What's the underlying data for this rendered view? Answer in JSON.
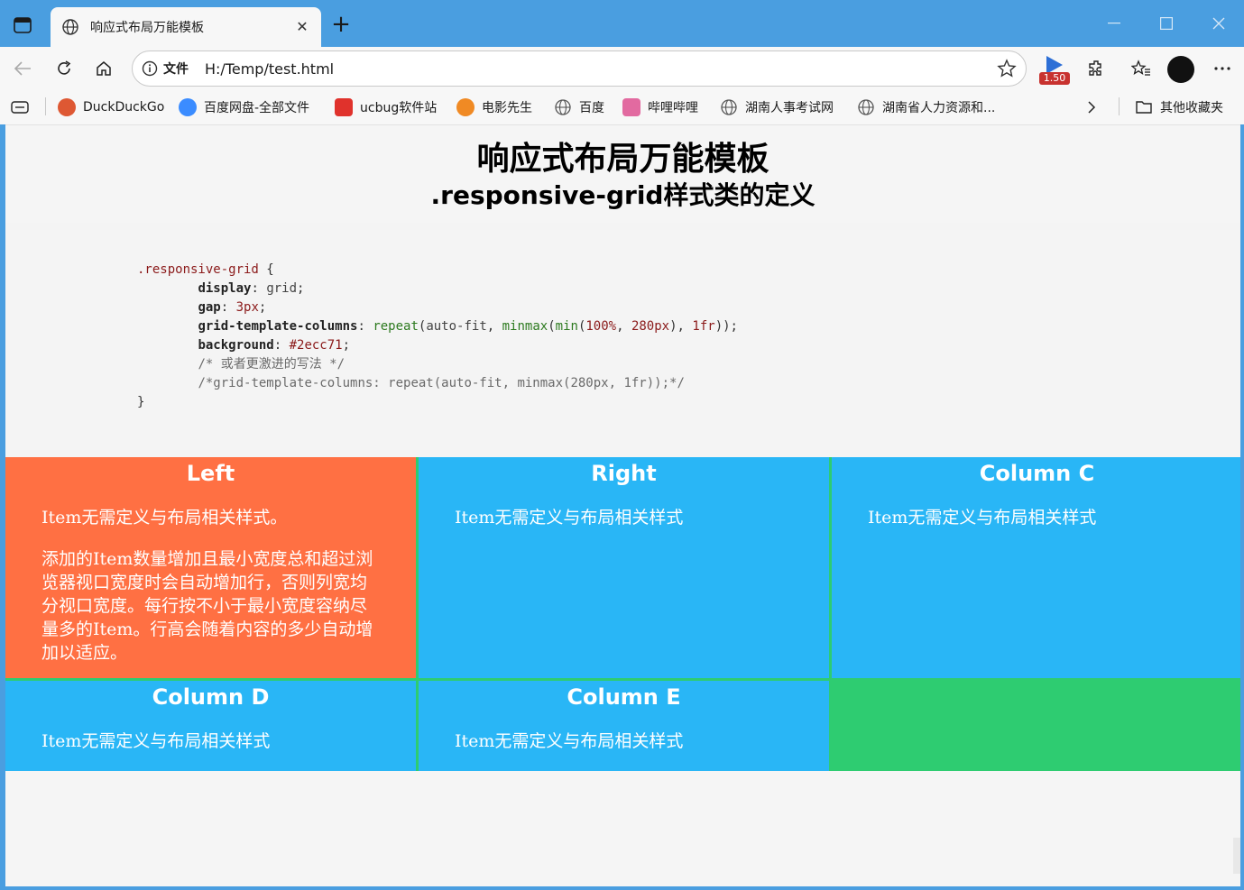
{
  "browser": {
    "tab_title": "响应式布局万能模板",
    "address_scheme": "文件",
    "address_url": "H:/Temp/test.html",
    "playback_rate": "1.50"
  },
  "bookmarks": [
    {
      "label": "DuckDuckGo",
      "color": "#de5833"
    },
    {
      "label": "百度网盘-全部文件",
      "color": "#3b8cff"
    },
    {
      "label": "ucbug软件站",
      "color": "#e0322c"
    },
    {
      "label": "电影先生",
      "color": "#f08a24"
    },
    {
      "label": "百度",
      "color": "#555555"
    },
    {
      "label": "哔哩哔哩",
      "color": "#e26aa0"
    },
    {
      "label": "湖南人事考试网",
      "color": "#555555"
    },
    {
      "label": "湖南省人力资源和...",
      "color": "#555555"
    }
  ],
  "other_bookmarks": "其他收藏夹",
  "page": {
    "title": "响应式布局万能模板",
    "subtitle": ".responsive-grid样式类的定义"
  },
  "grid": {
    "background": "#2ecc71",
    "items": [
      {
        "title": "Left",
        "paragraphs": [
          "Item无需定义与布局相关样式。",
          "添加的Item数量增加且最小宽度总和超过浏览器视口宽度时会自动增加行，否则列宽均分视口宽度。每行按不小于最小宽度容纳尽量多的Item。行高会随着内容的多少自动增加以适应。"
        ],
        "color": "#ff7043"
      },
      {
        "title": "Right",
        "paragraphs": [
          "Item无需定义与布局相关样式"
        ],
        "color": "#29b6f6"
      },
      {
        "title": "Column C",
        "paragraphs": [
          "Item无需定义与布局相关样式"
        ],
        "color": "#29b6f6"
      },
      {
        "title": "Column D",
        "paragraphs": [
          "Item无需定义与布局相关样式"
        ],
        "color": "#29b6f6"
      },
      {
        "title": "Column E",
        "paragraphs": [
          "Item无需定义与布局相关样式"
        ],
        "color": "#29b6f6"
      }
    ]
  }
}
